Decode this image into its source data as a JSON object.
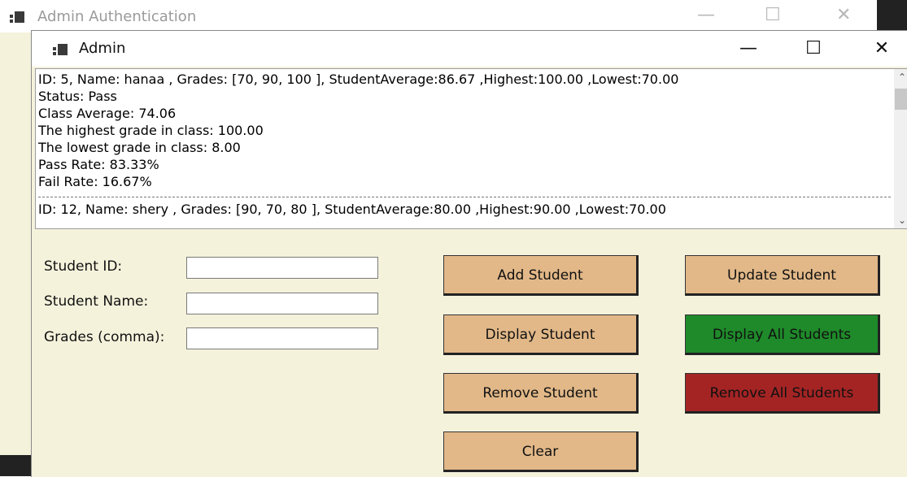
{
  "background_window": {
    "title": "Admin Authentication",
    "controls": [
      "—",
      "☐",
      "✕"
    ]
  },
  "window": {
    "title": "Admin",
    "controls": [
      "—",
      "☐",
      "✕"
    ]
  },
  "output": {
    "lines": [
      "ID: 5, Name: hanaa , Grades: [70, 90, 100 ], StudentAverage:86.67 ,Highest:100.00 ,Lowest:70.00",
      "Status: Pass",
      "Class Average: 74.06",
      "The highest grade in class: 100.00",
      "The lowest grade in class: 8.00",
      "Pass Rate: 83.33%",
      "Fail Rate: 16.67%"
    ],
    "after_separator": "ID: 12, Name: shery , Grades: [90, 70, 80 ], StudentAverage:80.00 ,Highest:90.00 ,Lowest:70.00"
  },
  "form": {
    "student_id_label": "Student ID:",
    "student_id_value": "",
    "student_name_label": "Student Name:",
    "student_name_value": "",
    "grades_label": "Grades (comma):",
    "grades_value": ""
  },
  "buttons": {
    "add": "Add Student",
    "update": "Update Student",
    "display": "Display Student",
    "display_all": "Display All Students",
    "remove": "Remove Student",
    "remove_all": "Remove All Students",
    "clear": "Clear"
  },
  "colors": {
    "button_tan": "#e2b888",
    "button_green": "#1f8a2a",
    "button_red": "#a42424",
    "form_background": "#f5f2dc"
  }
}
